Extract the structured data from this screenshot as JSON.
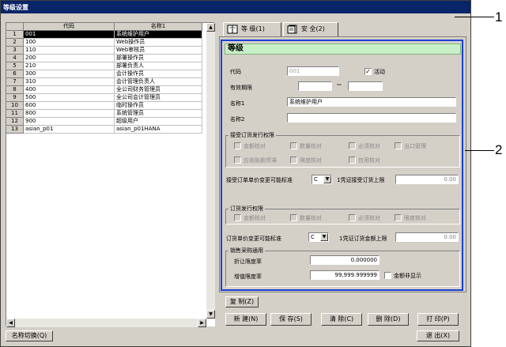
{
  "window": {
    "title": "等级设置"
  },
  "grid": {
    "columns": [
      "",
      "代码",
      "名称1"
    ],
    "rows": [
      {
        "num": "1",
        "code": "001",
        "name": "系统维护用户"
      },
      {
        "num": "2",
        "code": "100",
        "name": "Web操作员"
      },
      {
        "num": "3",
        "code": "110",
        "name": "Web审核员"
      },
      {
        "num": "4",
        "code": "200",
        "name": "部署操作员"
      },
      {
        "num": "5",
        "code": "210",
        "name": "部署负责人"
      },
      {
        "num": "6",
        "code": "300",
        "name": "会计操作员"
      },
      {
        "num": "7",
        "code": "310",
        "name": "会计管理负责人"
      },
      {
        "num": "8",
        "code": "400",
        "name": "全公司财务管理员"
      },
      {
        "num": "9",
        "code": "500",
        "name": "全公司会计管理员"
      },
      {
        "num": "10",
        "code": "600",
        "name": "临时操作员"
      },
      {
        "num": "11",
        "code": "800",
        "name": "系统管理员"
      },
      {
        "num": "12",
        "code": "900",
        "name": "超级用户"
      },
      {
        "num": "13",
        "code": "asian_p01",
        "name": "asian_p01HANA"
      }
    ],
    "selected_row": 0
  },
  "tabs": [
    {
      "label": "等 级(1)"
    },
    {
      "label": "安 全(2)"
    }
  ],
  "form": {
    "heading": "等级",
    "code_label": "代码",
    "code_value": "001",
    "active_label": "活动",
    "active_checked": true,
    "valid_label": "有效期限",
    "valid_sep": "~",
    "name1_label": "名称1",
    "name1_value": "系统维护用户",
    "name2_label": "名称2",
    "name2_value": "",
    "accept_group": "接受订货发行权限",
    "accept_checks": [
      "金额核对",
      "数量核对",
      "必须核对",
      "出口管理",
      "应收账款停滞",
      "限度核对",
      "信用核对"
    ],
    "accept_price_label": "接受订单单价变更可能标准",
    "accept_price_combo": "C",
    "accept_limit_label": "1凭证接受订货上限",
    "accept_limit_value": "0.00",
    "order_group": "订货发行权限",
    "order_checks": [
      "金额核对",
      "数量核对",
      "必须核对",
      "限度核对"
    ],
    "order_price_label": "订货单价变更可能标准",
    "order_price_combo": "C",
    "order_limit_label": "1凭证订货金额上限",
    "order_limit_value": "0.00",
    "sales_group": "销售采购通用",
    "discount_label": "折让限度率",
    "discount_value": "0.000000",
    "markup_label": "增值限度率",
    "markup_value": "99,999.999999",
    "hide_amount_label": "金额非显示"
  },
  "buttons": {
    "copy": "复 制(Z)",
    "new": "新 建(N)",
    "save": "保 存(S)",
    "clear": "清 除(C)",
    "delete": "删 除(D)",
    "print": "打 印(P)",
    "name_switch": "名称切换(Q)",
    "exit": "退 出(X)"
  },
  "callouts": [
    "1",
    "2"
  ]
}
